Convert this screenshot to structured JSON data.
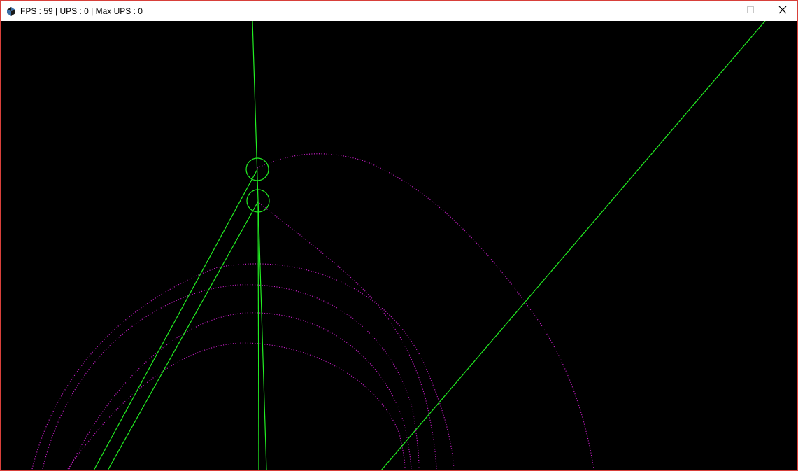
{
  "window": {
    "title": "FPS : 59 | UPS : 0 | Max UPS : 0",
    "app_icon": "java-cup-icon",
    "controls": {
      "minimize_icon": "minimize-icon",
      "maximize_icon": "maximize-icon",
      "close_icon": "close-icon"
    }
  },
  "colors": {
    "frame_border": "#d8403a",
    "canvas_background": "#000000",
    "line_color": "#22ee22",
    "trajectory_color": "#d21fd2"
  }
}
